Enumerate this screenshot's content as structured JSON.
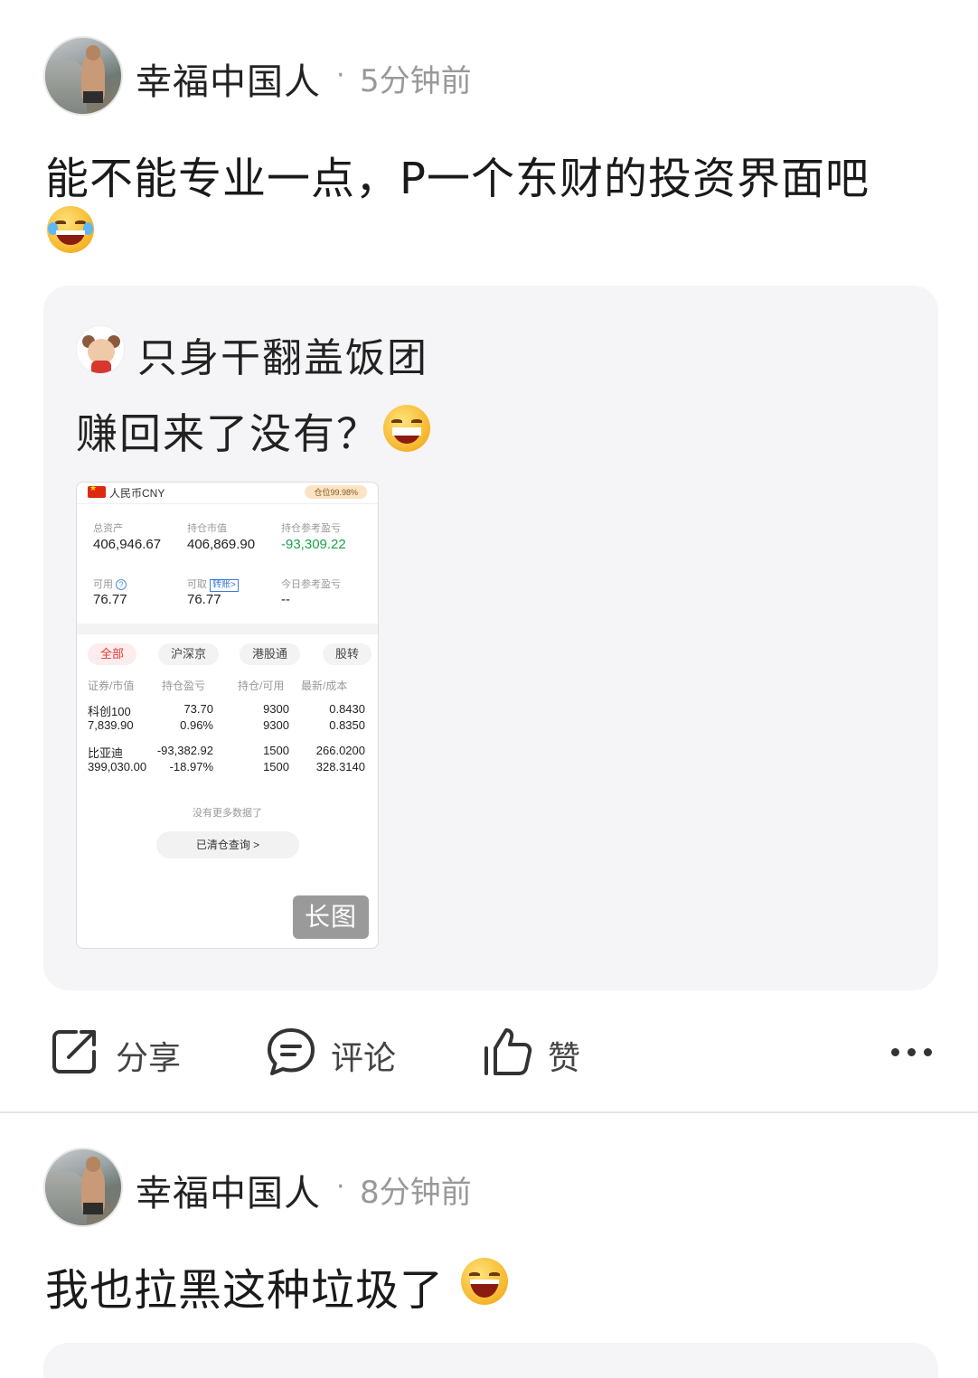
{
  "posts": [
    {
      "username": "幸福中国人",
      "separator": "·",
      "time": "5分钟前",
      "text": "能不能专业一点，P一个东财的投资界面吧",
      "emoji": "laughing-crying-emoji"
    },
    {
      "username": "幸福中国人",
      "separator": "·",
      "time": "8分钟前",
      "text": "我也拉黑这种垃圾了",
      "emoji": "laughing-emoji"
    }
  ],
  "quoted": {
    "username": "只身干翻盖饭团",
    "text": "赚回来了没有？",
    "emoji": "grinning-emoji",
    "long_image_tag": "长图",
    "screenshot": {
      "currency": "人民币CNY",
      "position_badge": "仓位99.98%",
      "total_assets_label": "总资产",
      "total_assets": "406,946.67",
      "market_value_label": "持仓市值",
      "market_value": "406,869.90",
      "ref_pnl_label": "持仓参考盈亏",
      "ref_pnl": "-93,309.22",
      "available_label": "可用",
      "available": "76.77",
      "withdrawable_label": "可取",
      "transfer_tag": "转账>",
      "withdrawable": "76.77",
      "today_pnl_label": "今日参考盈亏",
      "today_pnl": "--",
      "tabs": [
        "全部",
        "沪深京",
        "港股通",
        "股转"
      ],
      "columns": [
        "证券/市值",
        "持仓盈亏",
        "持仓/可用",
        "最新/成本"
      ],
      "rows": [
        {
          "name": "科创100",
          "value": "7,839.90",
          "pnl": "73.70",
          "pnl_pct": "0.96%",
          "hold": "9300",
          "avail": "9300",
          "latest": "0.8430",
          "cost": "0.8350"
        },
        {
          "name": "比亚迪",
          "value": "399,030.00",
          "pnl": "-93,382.92",
          "pnl_pct": "-18.97%",
          "hold": "1500",
          "avail": "1500",
          "latest": "266.0200",
          "cost": "328.3140"
        }
      ],
      "no_more": "没有更多数据了",
      "cleared_query": "已清仓查询 >"
    }
  },
  "actions": {
    "share": "分享",
    "comment": "评论",
    "like": "赞"
  },
  "icons": {
    "share": "share-icon",
    "comment": "comment-icon",
    "like": "thumbs-up-icon",
    "more": "more-icon"
  },
  "colors": {
    "gain": "#e03b3b",
    "loss": "#17a34a",
    "card_bg": "#f5f5f7"
  }
}
